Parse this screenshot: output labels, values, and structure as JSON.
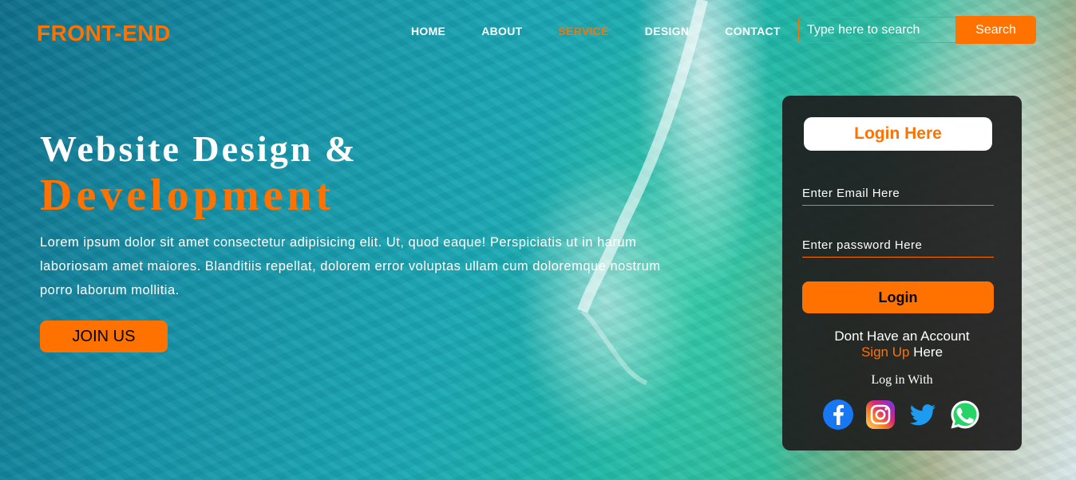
{
  "header": {
    "logo": "FRONT-END",
    "nav": [
      "HOME",
      "ABOUT",
      "SERVICE",
      "DESIGN",
      "CONTACT"
    ],
    "active_nav": "SERVICE",
    "search_placeholder": "Type here to search",
    "search_button": "Search"
  },
  "hero": {
    "title_line1": "Website Design &",
    "title_line2": "Development",
    "paragraph": "Lorem ipsum dolor sit amet consectetur adipisicing elit. Ut, quod eaque! Perspiciatis ut in harum laboriosam amet maiores. Blanditiis repellat, dolorem error voluptas ullam cum doloremque nostrum porro laborum mollitia.",
    "join_button": "JOIN US"
  },
  "login": {
    "title": "Login Here",
    "email_placeholder": "Enter Email Here",
    "password_placeholder": "Enter password Here",
    "login_button": "Login",
    "no_account": "Dont Have an Account",
    "signup_link": "Sign Up",
    "signup_suffix": " Here",
    "login_with": "Log in With",
    "socials": [
      "facebook-icon",
      "instagram-icon",
      "twitter-icon",
      "whatsapp-icon"
    ]
  },
  "colors": {
    "accent": "#ff7200",
    "card_bg": "#1e1e1e"
  }
}
